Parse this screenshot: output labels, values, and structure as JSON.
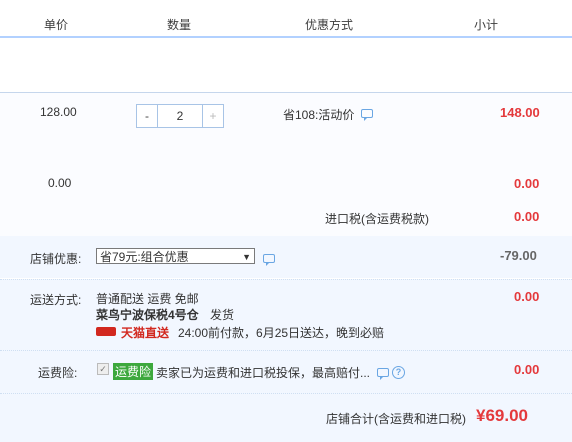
{
  "header": {
    "col_price": "单价",
    "col_qty": "数量",
    "col_discount": "优惠方式",
    "col_subtotal": "小计"
  },
  "item": {
    "unit_price": "128.00",
    "qty_minus": "-",
    "quantity": "2",
    "qty_plus": "+",
    "discount": "省108:活动价",
    "subtotal": "148.00",
    "extra_price": "0.00",
    "extra_subtotal": "0.00",
    "tax_label": "进口税(含运费税款)",
    "tax_value": "0.00"
  },
  "shop_discount": {
    "label": "店铺优惠:",
    "selected": "省79元:组合优惠",
    "value": "-79.00"
  },
  "shipping": {
    "label": "运送方式:",
    "method": "普通配送 运费 免邮",
    "warehouse": "菜鸟宁波保税4号仓",
    "ship_text": "发货",
    "tmall_brand": "天猫直送",
    "delivery_note": "24:00前付款，6月25日送达，晚到必赔",
    "value": "0.00"
  },
  "insurance": {
    "label": "运费险:",
    "badge": "运费险",
    "text": "卖家已为运费和进口税投保，最高赔付...",
    "value": "0.00"
  },
  "total": {
    "label": "店铺合计(含运费和进口税)",
    "value": "¥69.00"
  },
  "colors": {
    "accent_red": "#e4393c",
    "header_border": "#b2d1ff",
    "row_bg": "#f2f7ff"
  }
}
